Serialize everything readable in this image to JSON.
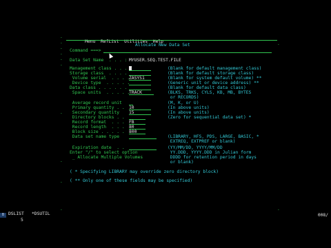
{
  "menu": {
    "items": [
      "Menu",
      "RefList",
      "Utilities",
      "Help"
    ]
  },
  "panel": {
    "title": "Allocate New Data Set",
    "command_label": "Command ===>",
    "dsn_label": "Data Set Name  . . . :",
    "dsn_value": "MYUSER.SEQ.TEST.FILE"
  },
  "fields": [
    {
      "label": "Management class . . .",
      "value": "",
      "help": "(Blank for default management class)"
    },
    {
      "label": "Storage class  . . . .",
      "value": "",
      "help": "(Blank for default storage class)"
    },
    {
      "label": " Volume serial  . . . .",
      "value": "ZASYS1",
      "help": "(Blank for system default volume) **"
    },
    {
      "label": " Device type  . . . . .",
      "value": "",
      "help": "(Generic unit or device address) **"
    },
    {
      "label": "Data class . . . . . .",
      "value": "",
      "help": "(Blank for default data class)"
    },
    {
      "label": " Space units  . . . . .",
      "value": "TRACK",
      "help": "(BLKS, TRKS, CYLS, KB, MB, BYTES"
    },
    {
      "label": "",
      "value": "",
      "help": " or RECORDS)"
    },
    {
      "label": " Average record unit",
      "value": "",
      "help": "(M, K, or U)"
    },
    {
      "label": " Primary quantity . .",
      "value": "10",
      "help": "(In above units)"
    },
    {
      "label": " Secondary quantity",
      "value": "15",
      "help": "(In above units)"
    },
    {
      "label": " Directory blocks . .",
      "value": "",
      "help": "(Zero for sequential data set) *"
    },
    {
      "label": " Record format  . . .",
      "value": "FB",
      "help": ""
    },
    {
      "label": " Record length  . . .",
      "value": "80",
      "help": ""
    },
    {
      "label": " Block size . . . . .",
      "value": "800",
      "help": ""
    },
    {
      "label": " Data set name type",
      "value": "",
      "help": "(LIBRARY, HFS, PDS, LARGE, BASIC, *"
    },
    {
      "label": "",
      "value": "",
      "help": " EXTREQ, EXTPREF or blank)"
    },
    {
      "label": " Expiration date  . .",
      "value": "",
      "help": "(YY/MM/DD, YYYY/MM/DD"
    },
    {
      "label": "Enter \"/\" to select option",
      "value": "",
      "help": " YY.DDD, YYYY.DDD in Julian form"
    },
    {
      "label": " _ Allocate Multiple Volumes",
      "value": "",
      "help": " DDDD for retention period in days"
    },
    {
      "label": "",
      "value": "",
      "help": " or blank)"
    }
  ],
  "notes": [
    "( * Specifying LIBRARY may override zero directory block)",
    "( ** Only one of these fields may be specified)"
  ],
  "status": {
    "pf1": "DSLIST",
    "pf2": "*DSUTIL",
    "pf_num": "5",
    "session": "B",
    "position": "008/"
  }
}
